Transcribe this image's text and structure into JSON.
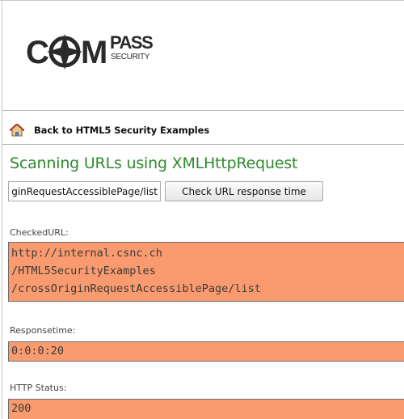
{
  "logo": {
    "main_text": "COMPASS",
    "sub_text": "SECURITY"
  },
  "nav": {
    "back_label": "Back to HTML5 Security Examples"
  },
  "page": {
    "title": "Scanning URLs using XMLHttpRequest"
  },
  "controls": {
    "url_value": "http://internal.csnc.ch/HTML5SecurityExamples/crossOriginRequestAccessiblePage/list",
    "check_button_label": "Check URL response time"
  },
  "results": {
    "checked_url_label": "CheckedURL:",
    "checked_url_lines": [
      "http://internal.csnc.ch",
      "/HTML5SecurityExamples",
      "/crossOriginRequestAccessiblePage/list"
    ],
    "response_time_label": "Responsetime:",
    "response_time_value": "0:0:0:20",
    "http_status_label": "HTTP Status:",
    "http_status_value": "200"
  },
  "colors": {
    "title_green": "#2f8a2f",
    "result_orange": "#f99b6e"
  },
  "icons": {
    "back": "home-icon"
  }
}
